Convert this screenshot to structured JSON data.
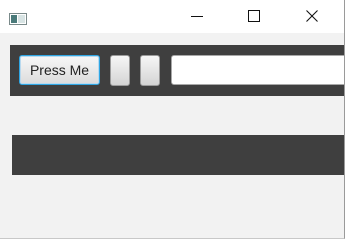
{
  "window": {
    "title": "",
    "controls": {
      "minimize_icon": "minimize-icon",
      "maximize_icon": "maximize-icon",
      "close_icon": "close-icon"
    }
  },
  "toolbar": {
    "press_button_label": "Press Me",
    "small_button_1_label": "",
    "small_button_2_label": "",
    "text_field_value": ""
  },
  "colors": {
    "toolbar_bg": "#3f3f3f",
    "focus_border": "#2fa6e3",
    "window_bg": "#f2f2f2"
  }
}
